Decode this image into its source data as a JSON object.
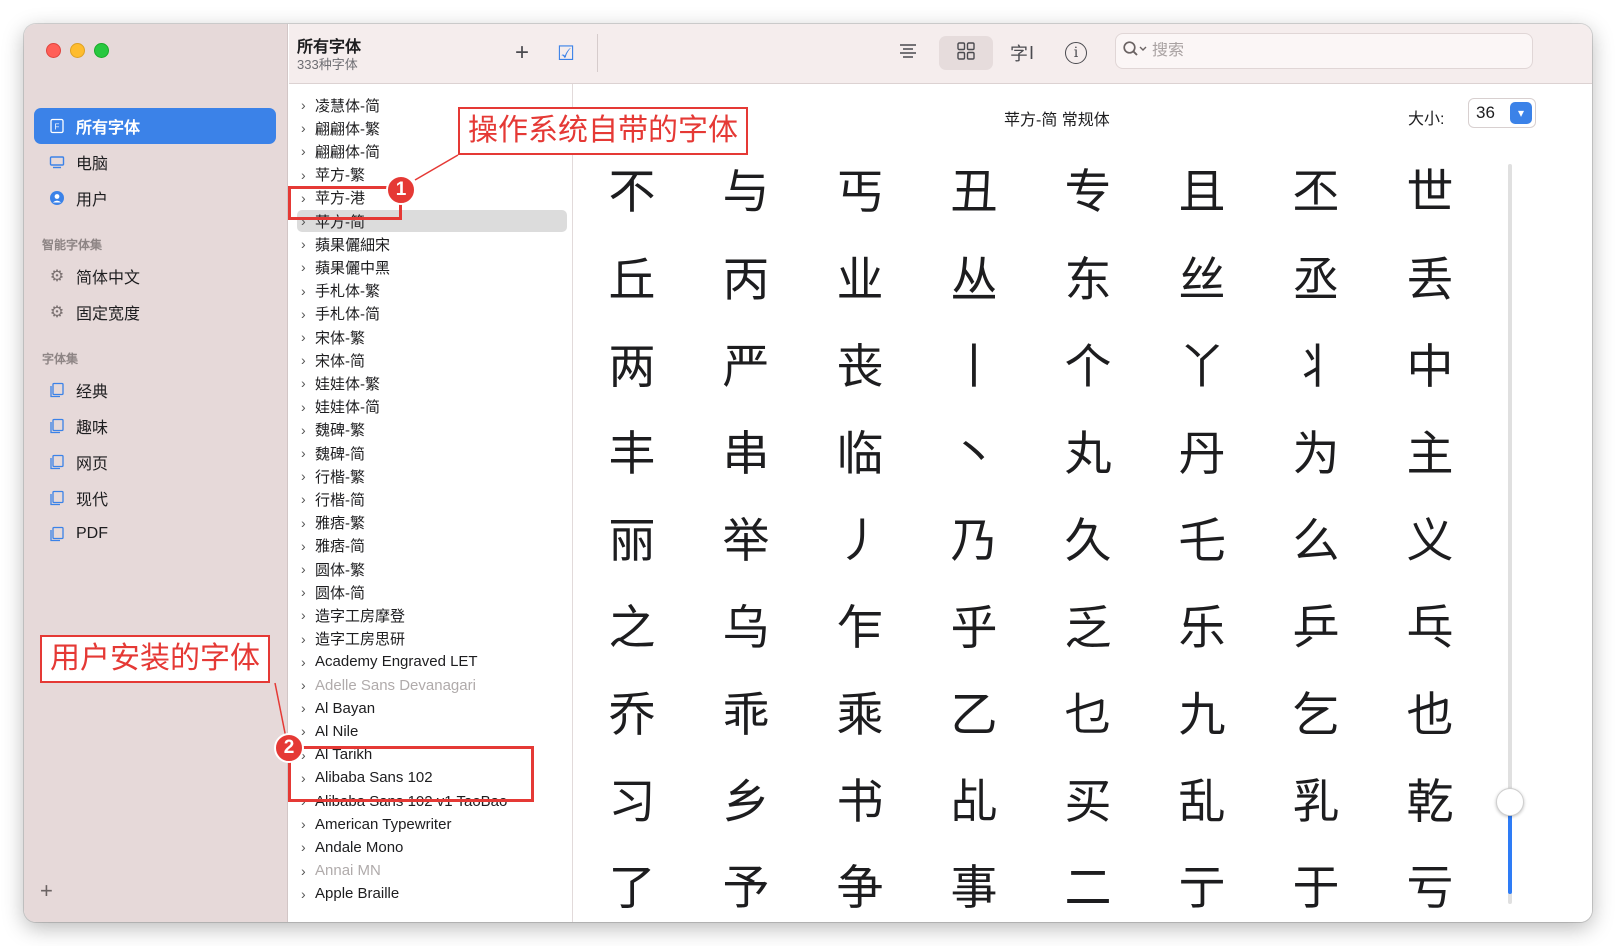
{
  "window": {
    "traffic_lights": [
      "close",
      "minimize",
      "zoom"
    ]
  },
  "sidebar": {
    "items": [
      {
        "label": "所有字体",
        "icon": "font-file-icon",
        "selected": true
      },
      {
        "label": "电脑",
        "icon": "computer-icon",
        "selected": false
      },
      {
        "label": "用户",
        "icon": "user-icon",
        "selected": false
      }
    ],
    "smart_section": "智能字体集",
    "smart_items": [
      {
        "label": "简体中文",
        "icon": "gear-icon"
      },
      {
        "label": "固定宽度",
        "icon": "gear-icon"
      }
    ],
    "collections_section": "字体集",
    "collection_items": [
      {
        "label": "经典",
        "icon": "collection-icon"
      },
      {
        "label": "趣味",
        "icon": "collection-icon"
      },
      {
        "label": "网页",
        "icon": "collection-icon"
      },
      {
        "label": "现代",
        "icon": "collection-icon"
      },
      {
        "label": "PDF",
        "icon": "collection-icon"
      }
    ],
    "add_label": "+"
  },
  "toolbar": {
    "title": "所有字体",
    "subtitle": "333种字体",
    "add_label": "+",
    "checkbox_label": "☑",
    "list_view_icon": "list-icon",
    "grid_view_icon": "grid-icon",
    "sample_icon_label": "字",
    "info_label": "i",
    "search_placeholder": "搜索"
  },
  "font_list": [
    {
      "name": "凌慧体-简",
      "dim": false
    },
    {
      "name": "翩翩体-繁",
      "dim": false
    },
    {
      "name": "翩翩体-简",
      "dim": false
    },
    {
      "name": "苹方-繁",
      "dim": false
    },
    {
      "name": "苹方-港",
      "dim": false
    },
    {
      "name": "苹方-简",
      "dim": false,
      "selected": true
    },
    {
      "name": "蘋果儷細宋",
      "dim": false
    },
    {
      "name": "蘋果儷中黑",
      "dim": false
    },
    {
      "name": "手札体-繁",
      "dim": false
    },
    {
      "name": "手札体-简",
      "dim": false
    },
    {
      "name": "宋体-繁",
      "dim": false
    },
    {
      "name": "宋体-简",
      "dim": false
    },
    {
      "name": "娃娃体-繁",
      "dim": false
    },
    {
      "name": "娃娃体-简",
      "dim": false
    },
    {
      "name": "魏碑-繁",
      "dim": false
    },
    {
      "name": "魏碑-简",
      "dim": false
    },
    {
      "name": "行楷-繁",
      "dim": false
    },
    {
      "name": "行楷-简",
      "dim": false
    },
    {
      "name": "雅痞-繁",
      "dim": false
    },
    {
      "name": "雅痞-简",
      "dim": false
    },
    {
      "name": "圆体-繁",
      "dim": false
    },
    {
      "name": "圆体-简",
      "dim": false
    },
    {
      "name": "造字工房摩登",
      "dim": false
    },
    {
      "name": "造字工房思研",
      "dim": false
    },
    {
      "name": "Academy Engraved LET",
      "dim": false
    },
    {
      "name": "Adelle Sans Devanagari",
      "dim": true
    },
    {
      "name": "Al Bayan",
      "dim": false
    },
    {
      "name": "Al Nile",
      "dim": false
    },
    {
      "name": "Al Tarikh",
      "dim": false
    },
    {
      "name": "Alibaba Sans 102",
      "dim": false
    },
    {
      "name": "Alibaba Sans 102 v1 TaoBao",
      "dim": false
    },
    {
      "name": "American Typewriter",
      "dim": false
    },
    {
      "name": "Andale Mono",
      "dim": false
    },
    {
      "name": "Annai MN",
      "dim": true
    },
    {
      "name": "Apple Braille",
      "dim": false
    }
  ],
  "preview": {
    "font_title": "苹方-简 常规体",
    "size_label": "大小:",
    "size_value": "36",
    "slider_fraction": 0.14,
    "glyph_rows": [
      [
        "不",
        "与",
        "丐",
        "丑",
        "专",
        "且",
        "丕",
        "世"
      ],
      [
        "丘",
        "丙",
        "业",
        "丛",
        "东",
        "丝",
        "丞",
        "丢"
      ],
      [
        "两",
        "严",
        "丧",
        "丨",
        "个",
        "丫",
        "丬",
        "中"
      ],
      [
        "丰",
        "串",
        "临",
        "丶",
        "丸",
        "丹",
        "为",
        "主"
      ],
      [
        "丽",
        "举",
        "丿",
        "乃",
        "久",
        "乇",
        "么",
        "义"
      ],
      [
        "之",
        "乌",
        "乍",
        "乎",
        "乏",
        "乐",
        "乒",
        "乓"
      ],
      [
        "乔",
        "乖",
        "乘",
        "乙",
        "乜",
        "九",
        "乞",
        "也"
      ],
      [
        "习",
        "乡",
        "书",
        "乩",
        "买",
        "乱",
        "乳",
        "乾"
      ],
      [
        "了",
        "予",
        "争",
        "事",
        "二",
        "亍",
        "于",
        "亏"
      ]
    ]
  },
  "annotations": {
    "system_fonts_label": "操作系统自带的字体",
    "user_fonts_label": "用户安装的字体",
    "badge_1": "1",
    "badge_2": "2"
  },
  "colors": {
    "accent": "#3b82e8",
    "annotation_red": "#e53935",
    "sidebar_bg": "#e6d9d9"
  }
}
